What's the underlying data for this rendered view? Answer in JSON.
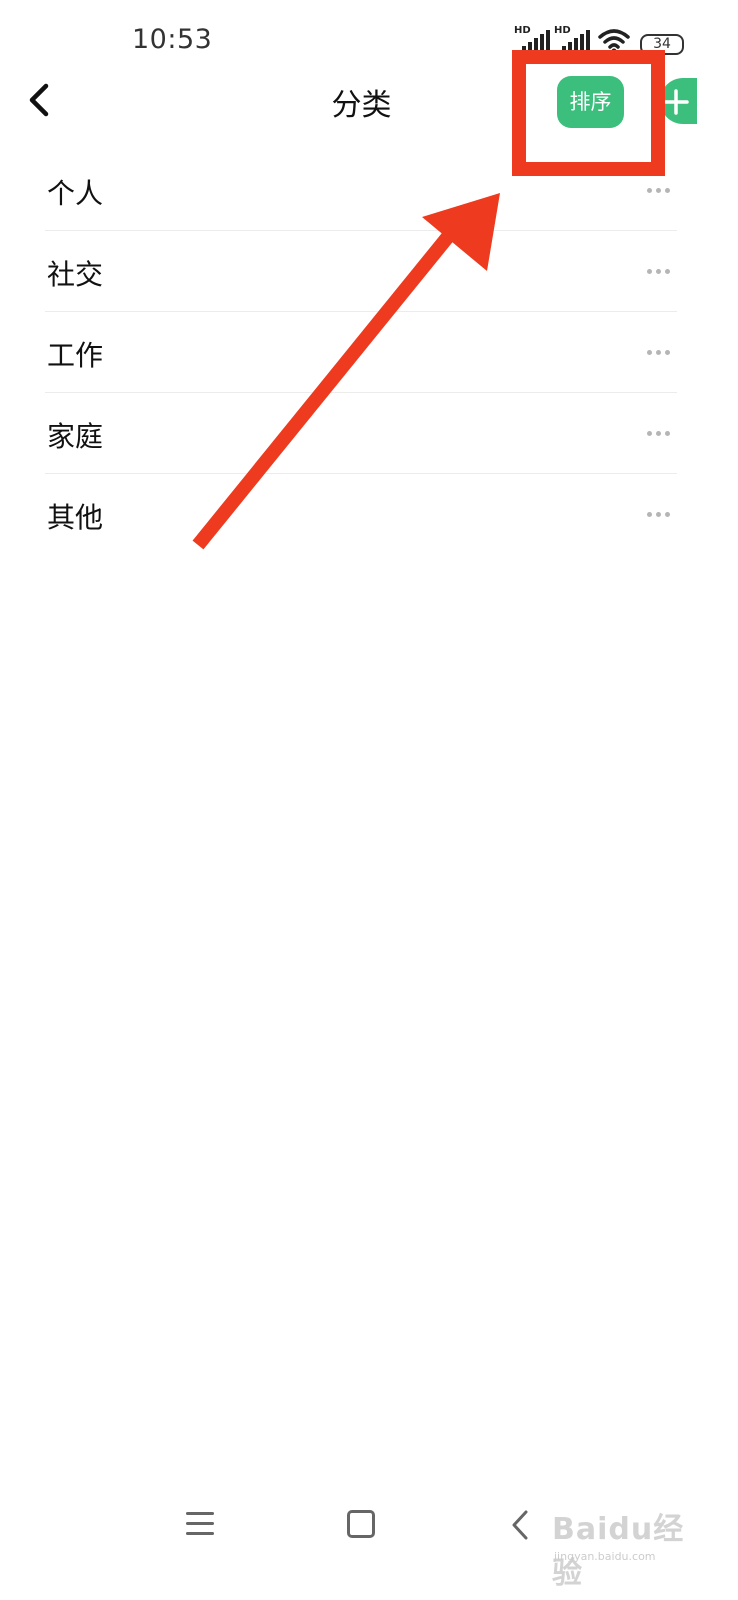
{
  "status_bar": {
    "time": "10:53",
    "signal_1_label": "HD",
    "signal_2_label": "HD",
    "battery": "34"
  },
  "header": {
    "title": "分类",
    "sort_label": "排序",
    "back_icon": "chevron-left-icon",
    "add_icon": "plus-icon"
  },
  "categories": [
    {
      "label": "个人"
    },
    {
      "label": "社交"
    },
    {
      "label": "工作"
    },
    {
      "label": "家庭"
    },
    {
      "label": "其他"
    }
  ],
  "annotation": {
    "color": "#ee3a1e"
  },
  "nav": {
    "icons": [
      "menu-icon",
      "home-icon",
      "back-icon"
    ]
  },
  "watermark": {
    "text": "Baidu经验",
    "url": "jingyan.baidu.com"
  },
  "colors": {
    "accent": "#3cbf7c",
    "annotation": "#ee3a1e"
  }
}
